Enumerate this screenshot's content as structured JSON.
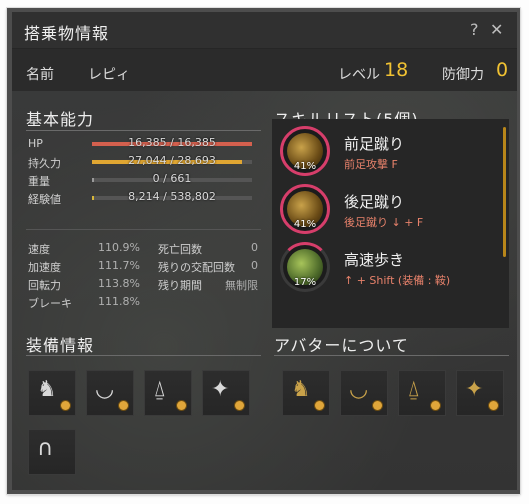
{
  "window": {
    "title": "搭乗物情報",
    "help_label": "?",
    "close_label": "✕"
  },
  "info": {
    "name_label": "名前",
    "name_value": "レピィ",
    "level_label": "レベル",
    "level_value": "18",
    "defense_label": "防御力",
    "defense_value": "0"
  },
  "basic": {
    "title": "基本能力",
    "bars": [
      {
        "label": "HP",
        "value": "16,385 / 16,385",
        "fraction": 1.0,
        "color": "#d4604e"
      },
      {
        "label": "持久力",
        "value": "27,044 / 28,693",
        "fraction": 0.94,
        "color": "#e0a632"
      },
      {
        "label": "重量",
        "value": "0 / 661",
        "fraction": 0.0,
        "color": "#9a9a9a"
      },
      {
        "label": "経験値",
        "value": "8,214 / 538,802",
        "fraction": 0.015,
        "color": "#d6b63a"
      }
    ],
    "stats_left": [
      {
        "label": "速度",
        "value": "110.9%"
      },
      {
        "label": "加速度",
        "value": "111.7%"
      },
      {
        "label": "回転力",
        "value": "113.8%"
      },
      {
        "label": "ブレーキ",
        "value": "111.8%"
      }
    ],
    "stats_right": [
      {
        "label": "死亡回数",
        "value": "0"
      },
      {
        "label": "残りの交配回数",
        "value": "0"
      },
      {
        "label": "残り期間",
        "value": "無制限"
      }
    ]
  },
  "skills": {
    "title": "スキルリスト(5個)",
    "items": [
      {
        "name": "前足蹴り",
        "command": "前足攻撃 F",
        "percent": "41%",
        "icon": "hoof-kick-icon"
      },
      {
        "name": "後足蹴り",
        "command": "後足蹴り ↓ + F",
        "percent": "41%",
        "icon": "back-kick-icon"
      },
      {
        "name": "高速歩き",
        "command": "↑ + Shift (装備 : 鞍)",
        "percent": "17%",
        "icon": "fast-walk-icon"
      }
    ]
  },
  "equipment": {
    "title": "装備情報",
    "slots": [
      "horse-head-icon",
      "saddle-icon",
      "stirrup-icon",
      "horse-armor-icon",
      "horseshoe-icon"
    ]
  },
  "avatar": {
    "title": "アバターについて",
    "slots": [
      "avatar-horse-head-icon",
      "avatar-saddle-icon",
      "avatar-stirrup-icon",
      "avatar-armor-icon"
    ]
  },
  "colors": {
    "accent_gold": "#f1c232",
    "skill_ring": "#d63e6b",
    "command_text": "#e8826b"
  }
}
